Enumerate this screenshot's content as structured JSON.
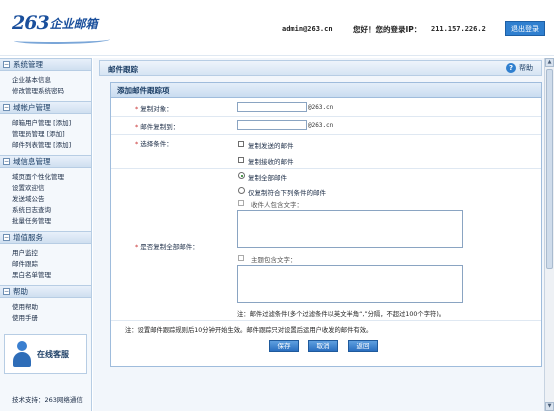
{
  "header": {
    "logo_number": "263",
    "logo_text": "企业邮箱",
    "user": "admin@263.cn",
    "welcome": "您好！您的登录IP：",
    "ip": "211.157.226.2",
    "logout": "退出登录"
  },
  "sidebar": {
    "sections": [
      {
        "title": "系统管理",
        "items": [
          "企业基本信息",
          "修改管理系统密码"
        ]
      },
      {
        "title": "域帐户管理",
        "items": [
          "邮箱用户管理 [添加]",
          "管理员管理 [添加]",
          "邮件列表管理 [添加]"
        ]
      },
      {
        "title": "域信息管理",
        "items": [
          "域页面个性化管理",
          "设置欢迎信",
          "发送域公告",
          "系统日志查询",
          "批量任务管理"
        ]
      },
      {
        "title": "增值服务",
        "items": [
          "用户监控",
          "邮件跟踪",
          "黑白名单管理"
        ]
      },
      {
        "title": "帮助",
        "items": [
          "使用帮助",
          "使用手册"
        ]
      }
    ],
    "customer_service": "在线客服",
    "support": "技术支持：263网络通信"
  },
  "main": {
    "title": "邮件跟踪",
    "help": "帮助",
    "panel_title": "添加邮件跟踪项",
    "copy_target_label": "复制对象：",
    "copy_target_value": "",
    "copy_target_suffix": "@263.cn",
    "copy_to_label": "邮件复制到：",
    "copy_to_value": "",
    "copy_to_suffix": "@263.cn",
    "condition_label": "选择条件：",
    "copy_sent": "复制发送的邮件",
    "copy_received": "复制接收的邮件",
    "copy_all_label": "是否复制全部邮件：",
    "copy_all_option": "复制全部邮件",
    "copy_match_option": "仅复制符合下列条件的邮件",
    "recipient_contains": "收件人包含文字：",
    "subject_contains": "主题包含文字：",
    "filter_note": "注：邮件过滤条件(多个过滤条件以英文半角“,”分隔，不超过100个字符)。",
    "bottom_note": "注：设置邮件跟踪规则后10分钟开始生效。邮件跟踪只对设置后运用户收发的邮件有效。"
  },
  "buttons": {
    "save": "保存",
    "cancel": "取消",
    "back": "返回"
  }
}
